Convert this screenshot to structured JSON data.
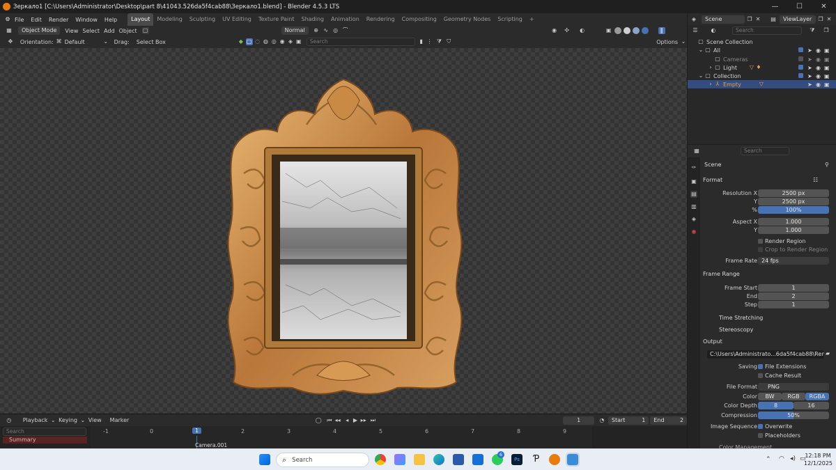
{
  "window": {
    "title": "Зеркало1 [C:\\Users\\Administrator\\Desktop\\part 8\\41043.526da5f4cab88\\Зеркало1.blend] - Blender 4.5.3 LTS"
  },
  "menu": [
    "File",
    "Edit",
    "Render",
    "Window",
    "Help"
  ],
  "workspaces": [
    "Layout",
    "Modeling",
    "Sculpting",
    "UV Editing",
    "Texture Paint",
    "Shading",
    "Animation",
    "Rendering",
    "Compositing",
    "Geometry Nodes",
    "Scripting"
  ],
  "active_workspace": "Layout",
  "scene_selector": {
    "scene": "Scene",
    "view_layer": "ViewLayer"
  },
  "viewport_header": {
    "mode": "Object Mode",
    "view": "View",
    "select": "Select",
    "add": "Add",
    "object": "Object",
    "orientation_label": "Normal"
  },
  "viewport_tools": {
    "orientation_label": "Orientation:",
    "orientation_value": "Default",
    "drag_label": "Drag:",
    "drag_value": "Select Box",
    "search_placeholder": "Search",
    "options": "Options"
  },
  "outliner": {
    "search_placeholder": "Search",
    "items": [
      {
        "label": "Scene Collection",
        "indent": 0
      },
      {
        "label": "All",
        "indent": 1
      },
      {
        "label": "Cameras",
        "indent": 2
      },
      {
        "label": "Light",
        "indent": 2
      },
      {
        "label": "Collection",
        "indent": 1
      },
      {
        "label": "Empty",
        "indent": 2
      }
    ]
  },
  "properties": {
    "search_placeholder": "Search",
    "context": "Scene",
    "format_section": "Format",
    "resolution_x_label": "Resolution X",
    "resolution_x": "2500 px",
    "resolution_y_label": "Y",
    "resolution_y": "2500 px",
    "percent_label": "%",
    "percent": "100%",
    "aspect_x_label": "Aspect X",
    "aspect_x": "1.000",
    "aspect_y_label": "Y",
    "aspect_y": "1.000",
    "render_region": "Render Region",
    "crop_region": "Crop to Render Region",
    "frame_rate_label": "Frame Rate",
    "frame_rate": "24 fps",
    "frame_range_section": "Frame Range",
    "frame_start_label": "Frame Start",
    "frame_start": "1",
    "end_label": "End",
    "end": "2",
    "step_label": "Step",
    "step": "1",
    "time_stretching": "Time Stretching",
    "stereoscopy": "Stereoscopy",
    "output_section": "Output",
    "output_path": "C:\\Users\\Administrato...6da5f4cab88\\Renders",
    "saving_label": "Saving",
    "file_extensions": "File Extensions",
    "cache_result": "Cache Result",
    "file_format_label": "File Format",
    "file_format": "PNG",
    "color_label": "Color",
    "color_opts": [
      "BW",
      "RGB",
      "RGBA"
    ],
    "color_depth_label": "Color Depth",
    "depth_opts": [
      "8",
      "16"
    ],
    "compression_label": "Compression",
    "compression": "50%",
    "image_sequence_label": "Image Sequence",
    "overwrite": "Overwrite",
    "placeholders": "Placeholders",
    "color_management": "Color Management"
  },
  "timeline": {
    "playback": "Playback",
    "keying": "Keying",
    "view": "View",
    "marker": "Marker",
    "current_frame": "1",
    "start_label": "Start",
    "start": "1",
    "end_label": "End",
    "end": "2",
    "search_placeholder": "Search",
    "summary": "Summary",
    "ruler": [
      "-1",
      "0",
      "1",
      "2",
      "3",
      "4",
      "5",
      "6",
      "7",
      "8",
      "9"
    ],
    "camera_marker": "Camera.001"
  },
  "taskbar": {
    "search_placeholder": "Search",
    "time": "12:18 PM",
    "date": "12/1/2025",
    "badge": "6"
  }
}
